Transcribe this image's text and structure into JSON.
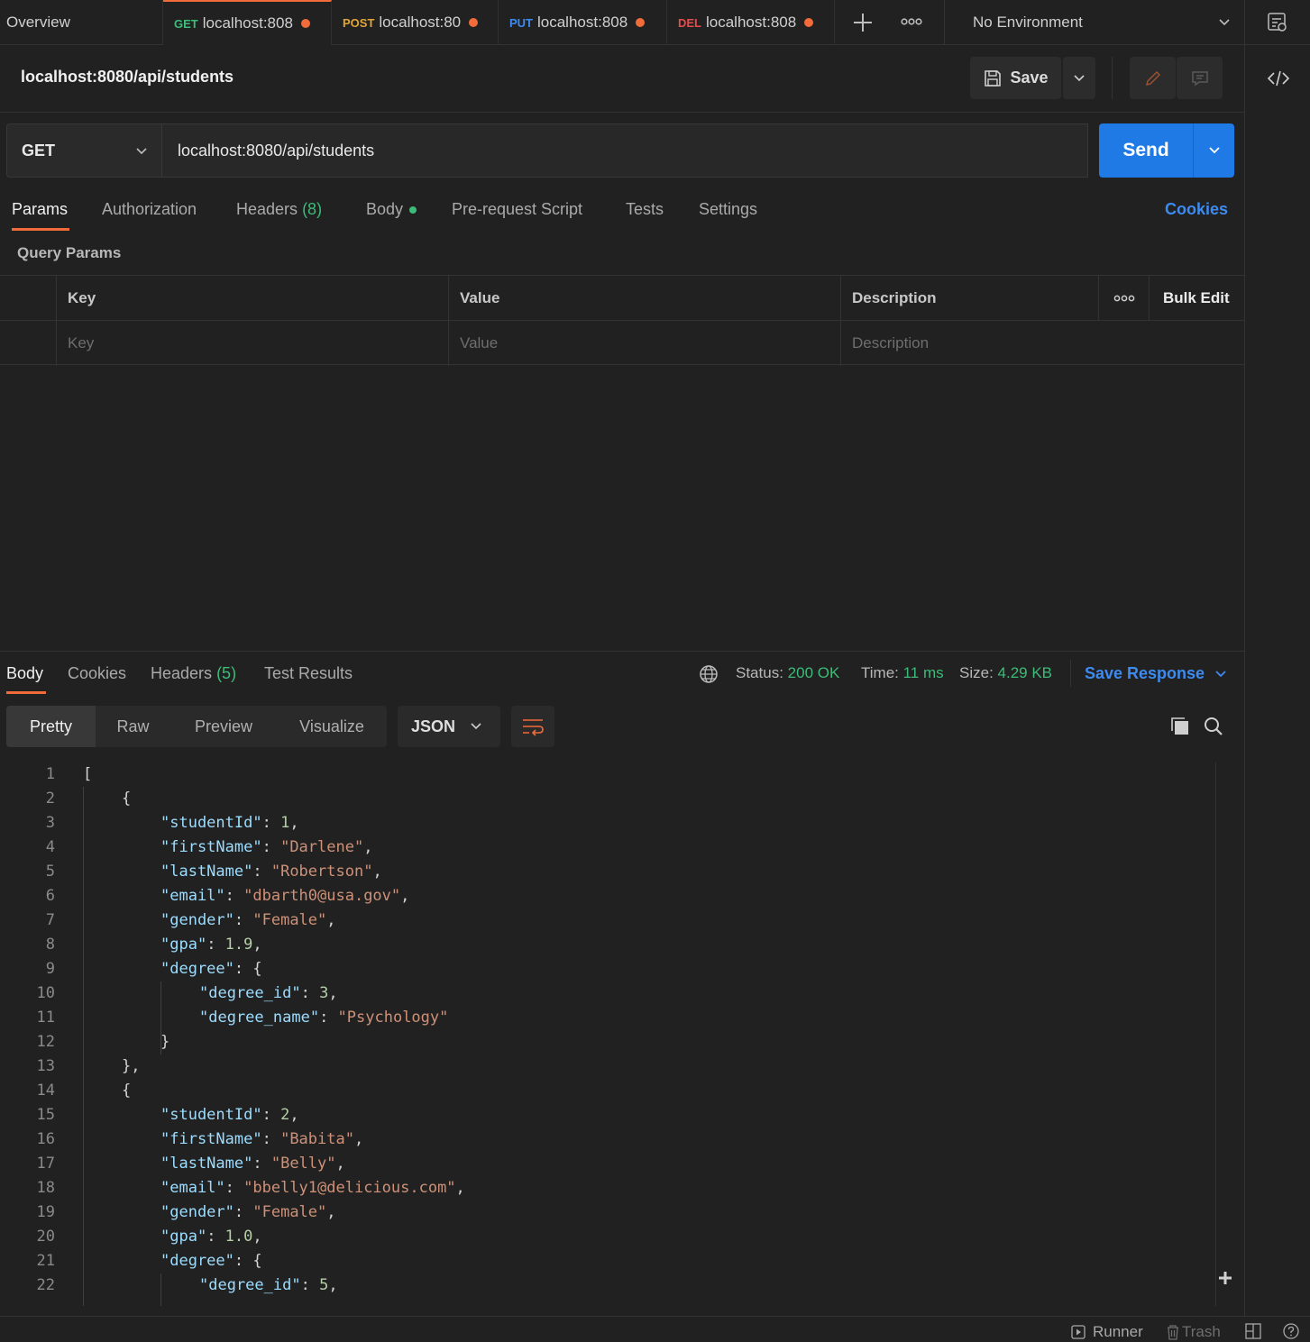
{
  "tabs": {
    "overview": "Overview",
    "items": [
      {
        "method": "GET",
        "method_color": "#3dbb78",
        "label": "localhost:808"
      },
      {
        "method": "POST",
        "method_color": "#e0a63a",
        "label": "localhost:80"
      },
      {
        "method": "PUT",
        "method_color": "#3d8bf0",
        "label": "localhost:808"
      },
      {
        "method": "DEL",
        "method_color": "#e54d4d",
        "label": "localhost:808"
      }
    ],
    "environment": "No Environment"
  },
  "request": {
    "title": "localhost:8080/api/students",
    "save_label": "Save",
    "method": "GET",
    "url": "localhost:8080/api/students",
    "send_label": "Send"
  },
  "request_tabs": {
    "params": "Params",
    "authorization": "Authorization",
    "headers": "Headers",
    "headers_count": "(8)",
    "body": "Body",
    "prerequest": "Pre-request Script",
    "tests": "Tests",
    "settings": "Settings",
    "cookies": "Cookies"
  },
  "params": {
    "section_label": "Query Params",
    "col_key": "Key",
    "col_value": "Value",
    "col_description": "Description",
    "bulk_edit": "Bulk Edit",
    "key_placeholder": "Key",
    "value_placeholder": "Value",
    "description_placeholder": "Description"
  },
  "response": {
    "tabs": {
      "body": "Body",
      "cookies": "Cookies",
      "headers": "Headers",
      "headers_count": "(5)",
      "test_results": "Test Results"
    },
    "status_label": "Status:",
    "status_value": "200 OK",
    "time_label": "Time:",
    "time_value": "11 ms",
    "size_label": "Size:",
    "size_value": "4.29 KB",
    "save_response": "Save Response",
    "views": {
      "pretty": "Pretty",
      "raw": "Raw",
      "preview": "Preview",
      "visualize": "Visualize"
    },
    "format": "JSON",
    "lines": [
      {
        "n": "1",
        "indent": 0,
        "parts": [
          [
            "p",
            "["
          ]
        ]
      },
      {
        "n": "2",
        "indent": 1,
        "parts": [
          [
            "p",
            "{"
          ]
        ]
      },
      {
        "n": "3",
        "indent": 2,
        "parts": [
          [
            "k",
            "\"studentId\""
          ],
          [
            "p",
            ": "
          ],
          [
            "n",
            "1"
          ],
          [
            "p",
            ","
          ]
        ]
      },
      {
        "n": "4",
        "indent": 2,
        "parts": [
          [
            "k",
            "\"firstName\""
          ],
          [
            "p",
            ": "
          ],
          [
            "s",
            "\"Darlene\""
          ],
          [
            "p",
            ","
          ]
        ]
      },
      {
        "n": "5",
        "indent": 2,
        "parts": [
          [
            "k",
            "\"lastName\""
          ],
          [
            "p",
            ": "
          ],
          [
            "s",
            "\"Robertson\""
          ],
          [
            "p",
            ","
          ]
        ]
      },
      {
        "n": "6",
        "indent": 2,
        "parts": [
          [
            "k",
            "\"email\""
          ],
          [
            "p",
            ": "
          ],
          [
            "s",
            "\"dbarth0@usa.gov\""
          ],
          [
            "p",
            ","
          ]
        ]
      },
      {
        "n": "7",
        "indent": 2,
        "parts": [
          [
            "k",
            "\"gender\""
          ],
          [
            "p",
            ": "
          ],
          [
            "s",
            "\"Female\""
          ],
          [
            "p",
            ","
          ]
        ]
      },
      {
        "n": "8",
        "indent": 2,
        "parts": [
          [
            "k",
            "\"gpa\""
          ],
          [
            "p",
            ": "
          ],
          [
            "n",
            "1.9"
          ],
          [
            "p",
            ","
          ]
        ]
      },
      {
        "n": "9",
        "indent": 2,
        "parts": [
          [
            "k",
            "\"degree\""
          ],
          [
            "p",
            ": {"
          ]
        ]
      },
      {
        "n": "10",
        "indent": 3,
        "parts": [
          [
            "k",
            "\"degree_id\""
          ],
          [
            "p",
            ": "
          ],
          [
            "n",
            "3"
          ],
          [
            "p",
            ","
          ]
        ]
      },
      {
        "n": "11",
        "indent": 3,
        "parts": [
          [
            "k",
            "\"degree_name\""
          ],
          [
            "p",
            ": "
          ],
          [
            "s",
            "\"Psychology\""
          ]
        ]
      },
      {
        "n": "12",
        "indent": 2,
        "parts": [
          [
            "p",
            "}"
          ]
        ]
      },
      {
        "n": "13",
        "indent": 1,
        "parts": [
          [
            "p",
            "},"
          ]
        ]
      },
      {
        "n": "14",
        "indent": 1,
        "parts": [
          [
            "p",
            "{"
          ]
        ]
      },
      {
        "n": "15",
        "indent": 2,
        "parts": [
          [
            "k",
            "\"studentId\""
          ],
          [
            "p",
            ": "
          ],
          [
            "n",
            "2"
          ],
          [
            "p",
            ","
          ]
        ]
      },
      {
        "n": "16",
        "indent": 2,
        "parts": [
          [
            "k",
            "\"firstName\""
          ],
          [
            "p",
            ": "
          ],
          [
            "s",
            "\"Babita\""
          ],
          [
            "p",
            ","
          ]
        ]
      },
      {
        "n": "17",
        "indent": 2,
        "parts": [
          [
            "k",
            "\"lastName\""
          ],
          [
            "p",
            ": "
          ],
          [
            "s",
            "\"Belly\""
          ],
          [
            "p",
            ","
          ]
        ]
      },
      {
        "n": "18",
        "indent": 2,
        "parts": [
          [
            "k",
            "\"email\""
          ],
          [
            "p",
            ": "
          ],
          [
            "s",
            "\"bbelly1@delicious.com\""
          ],
          [
            "p",
            ","
          ]
        ]
      },
      {
        "n": "19",
        "indent": 2,
        "parts": [
          [
            "k",
            "\"gender\""
          ],
          [
            "p",
            ": "
          ],
          [
            "s",
            "\"Female\""
          ],
          [
            "p",
            ","
          ]
        ]
      },
      {
        "n": "20",
        "indent": 2,
        "parts": [
          [
            "k",
            "\"gpa\""
          ],
          [
            "p",
            ": "
          ],
          [
            "n",
            "1.0"
          ],
          [
            "p",
            ","
          ]
        ]
      },
      {
        "n": "21",
        "indent": 2,
        "parts": [
          [
            "k",
            "\"degree\""
          ],
          [
            "p",
            ": {"
          ]
        ]
      },
      {
        "n": "22",
        "indent": 3,
        "parts": [
          [
            "k",
            "\"degree_id\""
          ],
          [
            "p",
            ": "
          ],
          [
            "n",
            "5"
          ],
          [
            "p",
            ","
          ]
        ]
      }
    ]
  },
  "statusbar": {
    "runner": "Runner",
    "trash": "Trash"
  },
  "icons": {
    "save": "floppy-disk-icon",
    "edit": "pencil-icon",
    "comment": "comment-icon",
    "code": "code-icon",
    "globe": "globe-icon",
    "copy": "copy-icon",
    "search": "search-icon",
    "wrap": "wrap-lines-icon",
    "help": "help-icon"
  }
}
